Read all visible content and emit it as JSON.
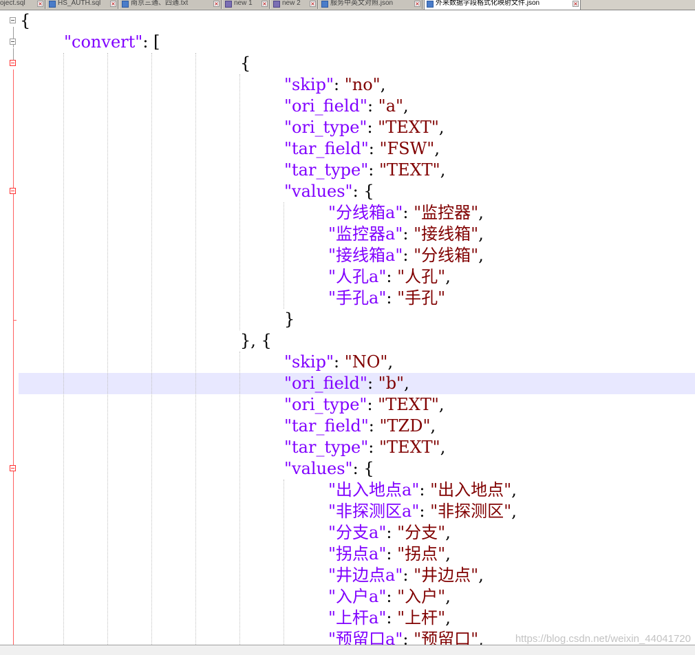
{
  "tabs": [
    {
      "label": "oject.sql",
      "icon": "file-icon",
      "active": false
    },
    {
      "label": "HS_AUTH.sql",
      "icon": "file-icon",
      "active": false
    },
    {
      "label": "南京三通、四通.txt",
      "icon": "file-icon",
      "active": false
    },
    {
      "label": "new 1",
      "icon": "new-file-icon",
      "active": false
    },
    {
      "label": "new 2",
      "icon": "new-file-icon",
      "active": false
    },
    {
      "label": "服务中英文对照.json",
      "icon": "file-icon",
      "active": false
    },
    {
      "label": "外来数据字段格式化映射文件.json",
      "icon": "file-icon",
      "active": true
    }
  ],
  "colors": {
    "key": "#8000ff",
    "string": "#800000",
    "caret_line": "#e8e8ff",
    "fold_marker": "#ff3030"
  },
  "code": {
    "l01": {
      "p1": "{"
    },
    "l02": {
      "k": "\"convert\"",
      "p1": ": ["
    },
    "l03": {
      "p1": "{"
    },
    "l04": {
      "k": "\"skip\"",
      "p1": ": ",
      "v": "\"no\"",
      "p2": ","
    },
    "l05": {
      "k": "\"ori_field\"",
      "p1": ": ",
      "v": "\"a\"",
      "p2": ","
    },
    "l06": {
      "k": "\"ori_type\"",
      "p1": ": ",
      "v": "\"TEXT\"",
      "p2": ","
    },
    "l07": {
      "k": "\"tar_field\"",
      "p1": ": ",
      "v": "\"FSW\"",
      "p2": ","
    },
    "l08": {
      "k": "\"tar_type\"",
      "p1": ": ",
      "v": "\"TEXT\"",
      "p2": ","
    },
    "l09": {
      "k": "\"values\"",
      "p1": ": {"
    },
    "l10": {
      "k": "\"分线箱a\"",
      "p1": ": ",
      "v": "\"监控器\"",
      "p2": ","
    },
    "l11": {
      "k": "\"监控器a\"",
      "p1": ": ",
      "v": "\"接线箱\"",
      "p2": ","
    },
    "l12": {
      "k": "\"接线箱a\"",
      "p1": ": ",
      "v": "\"分线箱\"",
      "p2": ","
    },
    "l13": {
      "k": "\"人孔a\"",
      "p1": ": ",
      "v": "\"人孔\"",
      "p2": ","
    },
    "l14": {
      "k": "\"手孔a\"",
      "p1": ": ",
      "v": "\"手孔\"",
      "p2": ""
    },
    "l15": {
      "p1": "}"
    },
    "l16": {
      "p1": "}, {"
    },
    "l17": {
      "k": "\"skip\"",
      "p1": ": ",
      "v": "\"NO\"",
      "p2": ","
    },
    "l18": {
      "k": "\"ori_field\"",
      "p1": ": ",
      "v": "\"b\"",
      "p2": ","
    },
    "l19": {
      "k": "\"ori_type\"",
      "p1": ": ",
      "v": "\"TEXT\"",
      "p2": ","
    },
    "l20": {
      "k": "\"tar_field\"",
      "p1": ": ",
      "v": "\"TZD\"",
      "p2": ","
    },
    "l21": {
      "k": "\"tar_type\"",
      "p1": ": ",
      "v": "\"TEXT\"",
      "p2": ","
    },
    "l22": {
      "k": "\"values\"",
      "p1": ": {"
    },
    "l23": {
      "k": "\"出入地点a\"",
      "p1": ": ",
      "v": "\"出入地点\"",
      "p2": ","
    },
    "l24": {
      "k": "\"非探测区a\"",
      "p1": ": ",
      "v": "\"非探测区\"",
      "p2": ","
    },
    "l25": {
      "k": "\"分支a\"",
      "p1": ": ",
      "v": "\"分支\"",
      "p2": ","
    },
    "l26": {
      "k": "\"拐点a\"",
      "p1": ": ",
      "v": "\"拐点\"",
      "p2": ","
    },
    "l27": {
      "k": "\"井边点a\"",
      "p1": ": ",
      "v": "\"井边点\"",
      "p2": ","
    },
    "l28": {
      "k": "\"入户a\"",
      "p1": ": ",
      "v": "\"入户\"",
      "p2": ","
    },
    "l29": {
      "k": "\"上杆a\"",
      "p1": ": ",
      "v": "\"上杆\"",
      "p2": ","
    },
    "l30": {
      "k": "\"预留口a\"",
      "p1": ": ",
      "v": "\"预留口\"",
      "p2": ","
    }
  },
  "watermark": "https://blog.csdn.net/weixin_44041720"
}
